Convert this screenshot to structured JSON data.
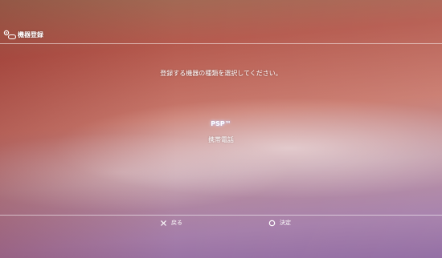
{
  "header": {
    "title": "機器登録",
    "icon": "device-register-icon"
  },
  "instruction": "登録する機器の種類を選択してください。",
  "options": [
    {
      "label": "PSP™",
      "selected": true
    },
    {
      "label": "携帯電話",
      "selected": false
    }
  ],
  "footer": {
    "back_icon": "cross-button-icon",
    "back_label": "戻る",
    "confirm_icon": "circle-button-icon",
    "confirm_label": "決定"
  },
  "colors": {
    "text": "#ffffff",
    "divider": "#ffffffcc"
  }
}
